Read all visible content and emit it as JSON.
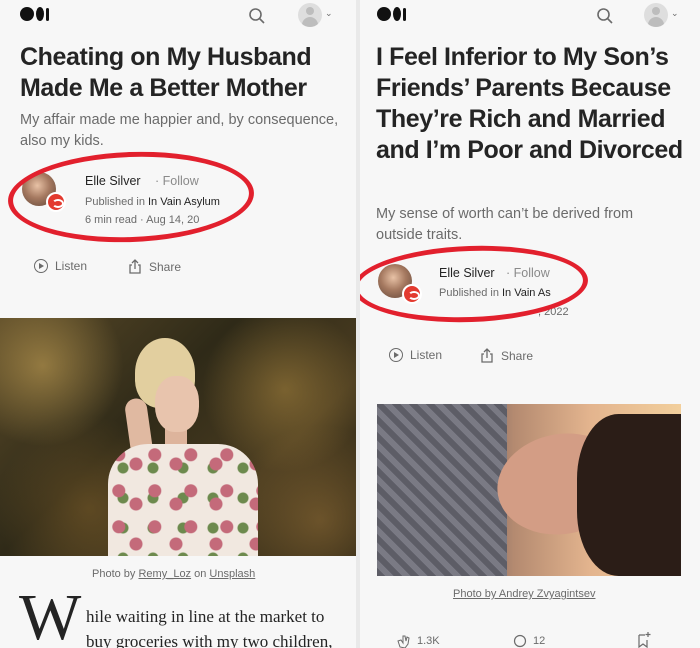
{
  "left": {
    "title": "Cheating on My Husband Made Me a Better Mother",
    "subtitle": "My affair made me happier and, by consequence, also my kids.",
    "author_name": "Elle Silver",
    "follow": "· Follow",
    "published_prefix": "Published in ",
    "publication": "In Vain Asylum",
    "read_time": "6 min read",
    "date": "· Aug 14, 20",
    "listen": "Listen",
    "share": "Share",
    "caption_prefix": "Photo by ",
    "caption_author": "Remy_Loz",
    "caption_mid": " on ",
    "caption_site": "Unsplash",
    "dropcap": "W",
    "body_line1": "hile waiting in line at the market to",
    "body_line2": "buy groceries with my two children,"
  },
  "right": {
    "title": "I Feel Inferior to My Son’s Friends’ Parents Because They’re Rich and Married and I’m Poor and Divorced",
    "subtitle": "My sense of worth can’t be derived from outside traits.",
    "author_name": "Elle Silver",
    "follow": "· Follow",
    "published_prefix": "Published in ",
    "publication": "In Vain As",
    "date_fragment": ", 2022",
    "listen": "Listen",
    "share": "Share",
    "caption": "Photo by Andrey Zvyagintsev",
    "claps": "1.3K",
    "responses": "12"
  },
  "colors": {
    "highlight_ring": "#e2202d",
    "publication_badge": "#e33a2f"
  }
}
